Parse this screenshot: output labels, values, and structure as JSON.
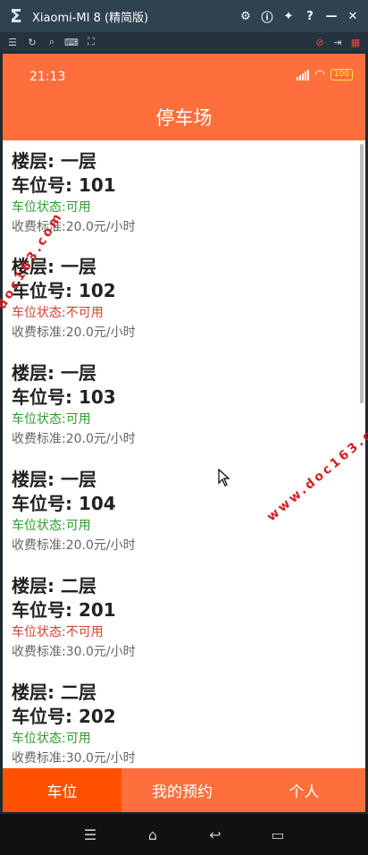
{
  "emulator": {
    "title": "Xiaomi-MI 8 (精简版)"
  },
  "status_bar": {
    "time": "21:13",
    "battery": "100"
  },
  "app": {
    "title": "停车场"
  },
  "spots": [
    {
      "floor": "楼层: 一层",
      "number": "车位号: 101",
      "status": "车位状态:可用",
      "available": true,
      "fee": "收费标准:20.0元/小时"
    },
    {
      "floor": "楼层: 一层",
      "number": "车位号: 102",
      "status": "车位状态:不可用",
      "available": false,
      "fee": "收费标准:20.0元/小时"
    },
    {
      "floor": "楼层: 一层",
      "number": "车位号: 103",
      "status": "车位状态:可用",
      "available": true,
      "fee": "收费标准:20.0元/小时"
    },
    {
      "floor": "楼层: 一层",
      "number": "车位号: 104",
      "status": "车位状态:可用",
      "available": true,
      "fee": "收费标准:20.0元/小时"
    },
    {
      "floor": "楼层: 二层",
      "number": "车位号: 201",
      "status": "车位状态:不可用",
      "available": false,
      "fee": "收费标准:30.0元/小时"
    },
    {
      "floor": "楼层: 二层",
      "number": "车位号: 202",
      "status": "车位状态:可用",
      "available": true,
      "fee": "收费标准:30.0元/小时"
    }
  ],
  "bottom_nav": {
    "items": [
      "车位",
      "我的预约",
      "个人"
    ],
    "active_index": 0
  },
  "watermarks": [
    "doc163.com",
    "www.doc163.com"
  ],
  "colors": {
    "brand": "#ff6f3c",
    "brand_active": "#ff5100",
    "available": "#2e9d2e",
    "unavailable": "#d6402e"
  }
}
